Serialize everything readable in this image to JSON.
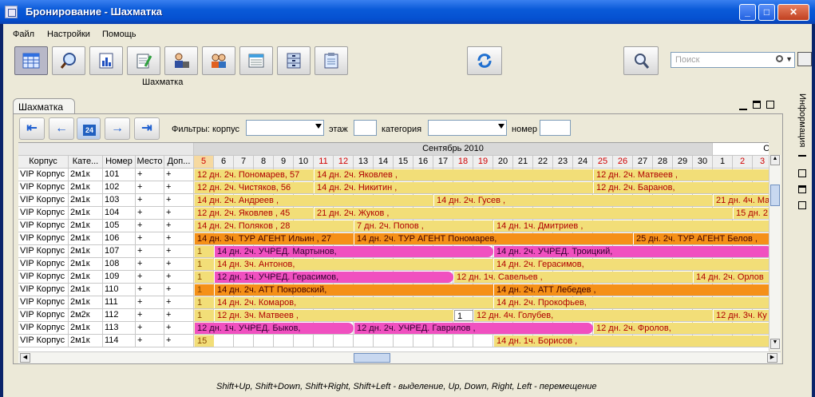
{
  "window": {
    "title": "Бронирование - Шахматка"
  },
  "menu": [
    "Файл",
    "Настройки",
    "Помощь"
  ],
  "toolbar": {
    "active_label": "Шахматка",
    "buttons": [
      "calendar-grid-icon",
      "magnifier-icon",
      "report-icon",
      "notepad-icon",
      "cashier-icon",
      "guests-icon",
      "list-edit-icon",
      "cabinet-icon",
      "clipboard-icon"
    ],
    "refresh_icon": "refresh-icon",
    "search_icon": "search-icon"
  },
  "search": {
    "placeholder": "Поиск"
  },
  "panel": {
    "tab_label": "Шахматка",
    "filters": {
      "korpus_label": "Фильтры: корпус",
      "floor_label": "этаж",
      "category_label": "категория",
      "number_label": "номер"
    },
    "nav": {
      "first": "⇤",
      "prev": "←",
      "today": "24",
      "next": "→",
      "last": "⇥"
    }
  },
  "side_panel": {
    "label": "Информация"
  },
  "grid": {
    "columns": [
      "Корпус",
      "Кате...",
      "Номер",
      "Место",
      "Доп..."
    ],
    "month1": "Сентябрь 2010",
    "month2": "Октяб",
    "days": [
      "5",
      "6",
      "7",
      "8",
      "9",
      "10",
      "11",
      "12",
      "13",
      "14",
      "15",
      "16",
      "17",
      "18",
      "19",
      "20",
      "21",
      "22",
      "23",
      "24",
      "25",
      "26",
      "27",
      "28",
      "29",
      "30",
      "1",
      "2",
      "3"
    ],
    "weekend_days": [
      "5",
      "11",
      "12",
      "18",
      "19",
      "25",
      "26",
      "2",
      "3"
    ],
    "rows": [
      {
        "korpus": "VIP Корпус",
        "cat": "2м1к",
        "num": "101",
        "place": "+",
        "dop": "+"
      },
      {
        "korpus": "VIP Корпус",
        "cat": "2м1к",
        "num": "102",
        "place": "+",
        "dop": "+"
      },
      {
        "korpus": "VIP Корпус",
        "cat": "2м1к",
        "num": "103",
        "place": "+",
        "dop": "+"
      },
      {
        "korpus": "VIP Корпус",
        "cat": "2м1к",
        "num": "104",
        "place": "+",
        "dop": "+"
      },
      {
        "korpus": "VIP Корпус",
        "cat": "2м1к",
        "num": "105",
        "place": "+",
        "dop": "+"
      },
      {
        "korpus": "VIP Корпус",
        "cat": "2м1к",
        "num": "106",
        "place": "+",
        "dop": "+"
      },
      {
        "korpus": "VIP Корпус",
        "cat": "2м1к",
        "num": "107",
        "place": "+",
        "dop": "+"
      },
      {
        "korpus": "VIP Корпус",
        "cat": "2м1к",
        "num": "108",
        "place": "+",
        "dop": "+"
      },
      {
        "korpus": "VIP Корпус",
        "cat": "2м1к",
        "num": "109",
        "place": "+",
        "dop": "+"
      },
      {
        "korpus": "VIP Корпус",
        "cat": "2м1к",
        "num": "110",
        "place": "+",
        "dop": "+"
      },
      {
        "korpus": "VIP Корпус",
        "cat": "2м1к",
        "num": "111",
        "place": "+",
        "dop": "+"
      },
      {
        "korpus": "VIP Корпус",
        "cat": "2м2к",
        "num": "112",
        "place": "+",
        "dop": "+"
      },
      {
        "korpus": "VIP Корпус",
        "cat": "2м1к",
        "num": "113",
        "place": "+",
        "dop": "+"
      },
      {
        "korpus": "VIP Корпус",
        "cat": "2м1к",
        "num": "114",
        "place": "+",
        "dop": "+"
      }
    ],
    "bookings": [
      {
        "row": 0,
        "start": 0,
        "len": 6,
        "text": "12 дн. 2ч.  Пономарев, 57",
        "color": "#f2de78"
      },
      {
        "row": 0,
        "start": 6,
        "len": 14,
        "text": "14 дн. 2ч.  Яковлев ,",
        "color": "#f2de78"
      },
      {
        "row": 0,
        "start": 20,
        "len": 9,
        "text": "12 дн. 2ч.  Матвеев ,",
        "color": "#f2de78"
      },
      {
        "row": 1,
        "start": 0,
        "len": 6,
        "text": "12 дн. 2ч.  Чистяков, 56",
        "color": "#f2de78"
      },
      {
        "row": 1,
        "start": 6,
        "len": 14,
        "text": "14 дн. 2ч.  Никитин ,",
        "color": "#f2de78"
      },
      {
        "row": 1,
        "start": 20,
        "len": 9,
        "text": "12 дн. 2ч.  Баранов,",
        "color": "#f2de78"
      },
      {
        "row": 2,
        "start": 0,
        "len": 12,
        "text": "14 дн. 2ч.  Андреев ,",
        "color": "#f2de78"
      },
      {
        "row": 2,
        "start": 12,
        "len": 14,
        "text": "14 дн. 2ч.  Гусев ,",
        "color": "#f2de78"
      },
      {
        "row": 2,
        "start": 26,
        "len": 3,
        "text": "21 дн. 4ч.  Ма",
        "color": "#f2de78"
      },
      {
        "row": 3,
        "start": 0,
        "len": 6,
        "text": "12 дн. 2ч.  Яковлев , 45",
        "color": "#f2de78"
      },
      {
        "row": 3,
        "start": 6,
        "len": 21,
        "text": "21 дн. 2ч.  Жуков ,",
        "color": "#f2de78"
      },
      {
        "row": 3,
        "start": 27,
        "len": 2,
        "text": "15 дн. 2",
        "color": "#f2de78"
      },
      {
        "row": 4,
        "start": 0,
        "len": 8,
        "text": "14 дн. 2ч.  Поляков , 28",
        "color": "#f2de78"
      },
      {
        "row": 4,
        "start": 8,
        "len": 7,
        "text": "7 дн. 2ч.  Попов ,",
        "color": "#f2de78"
      },
      {
        "row": 4,
        "start": 15,
        "len": 14,
        "text": "14 дн. 1ч.  Дмитриев ,",
        "color": "#f2de78"
      },
      {
        "row": 5,
        "start": 0,
        "len": 8,
        "text": "14 дн. 3ч. ТУР АГЕНТ Ильин , 27",
        "color": "#f59018"
      },
      {
        "row": 5,
        "start": 8,
        "len": 14,
        "text": "14 дн. 2ч. ТУР АГЕНТ Пономарев,",
        "color": "#f59018"
      },
      {
        "row": 5,
        "start": 22,
        "len": 7,
        "text": "25 дн. 2ч. ТУР АГЕНТ Белов ,",
        "color": "#f59018"
      },
      {
        "row": 6,
        "start": 0,
        "len": 1,
        "text": "1",
        "color": "#f2de78"
      },
      {
        "row": 6,
        "start": 1,
        "len": 14,
        "text": "14 дн. 2ч. УЧРЕД. Мартынов,",
        "color": "#f050c0"
      },
      {
        "row": 6,
        "start": 15,
        "len": 14,
        "text": "14 дн. 2ч. УЧРЕД. Троицкий,",
        "color": "#f050c0"
      },
      {
        "row": 7,
        "start": 0,
        "len": 1,
        "text": "1",
        "color": "#f2de78"
      },
      {
        "row": 7,
        "start": 1,
        "len": 14,
        "text": "14 дн. 3ч.  Антонов,",
        "color": "#f2de78"
      },
      {
        "row": 7,
        "start": 15,
        "len": 14,
        "text": "14 дн. 2ч.  Герасимов,",
        "color": "#f2de78"
      },
      {
        "row": 8,
        "start": 0,
        "len": 1,
        "text": "1",
        "color": "#f2de78"
      },
      {
        "row": 8,
        "start": 1,
        "len": 12,
        "text": "12 дн. 1ч. УЧРЕД. Герасимов,",
        "color": "#f050c0"
      },
      {
        "row": 8,
        "start": 13,
        "len": 12,
        "text": "12 дн. 1ч.  Савельев ,",
        "color": "#f2de78"
      },
      {
        "row": 8,
        "start": 25,
        "len": 4,
        "text": "14 дн. 2ч.  Орлов",
        "color": "#f2de78"
      },
      {
        "row": 9,
        "start": 0,
        "len": 1,
        "text": "1",
        "color": "#f59018"
      },
      {
        "row": 9,
        "start": 1,
        "len": 14,
        "text": "14 дн. 2ч. АТТ Покровский,",
        "color": "#f59018"
      },
      {
        "row": 9,
        "start": 15,
        "len": 14,
        "text": "14 дн. 2ч. АТТ Лебедев ,",
        "color": "#f59018"
      },
      {
        "row": 10,
        "start": 0,
        "len": 1,
        "text": "1",
        "color": "#f2de78"
      },
      {
        "row": 10,
        "start": 1,
        "len": 14,
        "text": "14 дн. 2ч.  Комаров,",
        "color": "#f2de78"
      },
      {
        "row": 10,
        "start": 15,
        "len": 14,
        "text": "14 дн. 2ч.  Прокофьев,",
        "color": "#f2de78"
      },
      {
        "row": 11,
        "start": 0,
        "len": 1,
        "text": "1",
        "color": "#f2de78"
      },
      {
        "row": 11,
        "start": 1,
        "len": 12,
        "text": "12 дн. 3ч.  Матвеев ,",
        "color": "#f2de78"
      },
      {
        "row": 11,
        "start": 13,
        "len": 1,
        "text": "1",
        "color": "#ffffff"
      },
      {
        "row": 11,
        "start": 14,
        "len": 12,
        "text": "12 дн. 4ч.  Голубев,",
        "color": "#f2de78"
      },
      {
        "row": 11,
        "start": 26,
        "len": 3,
        "text": "12 дн. 3ч.  Ку",
        "color": "#f2de78"
      },
      {
        "row": 12,
        "start": 0,
        "len": 8,
        "text": "12 дн. 1ч. УЧРЕД. Быков,",
        "color": "#f050c0"
      },
      {
        "row": 12,
        "start": 8,
        "len": 12,
        "text": "12 дн. 2ч. УЧРЕД. Гаврилов ,",
        "color": "#f050c0"
      },
      {
        "row": 12,
        "start": 20,
        "len": 9,
        "text": "12 дн. 2ч.  Фролов,",
        "color": "#f2de78"
      },
      {
        "row": 13,
        "start": 0,
        "len": 1,
        "text": "15",
        "color": "#f2de78"
      },
      {
        "row": 13,
        "start": 15,
        "len": 14,
        "text": "14 дн. 1ч.  Борисов ,",
        "color": "#f2de78"
      }
    ]
  },
  "status": {
    "text": "Shift+Up, Shift+Down, Shift+Right, Shift+Left - выделение, Up, Down, Right, Left - перемещение"
  },
  "colors": {
    "accent": "#0a5ad8",
    "weekend": "#d00000",
    "today": "#f6d9a0"
  }
}
